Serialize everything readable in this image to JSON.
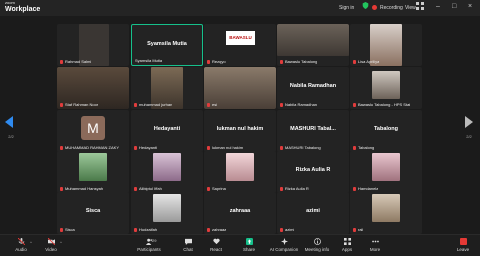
{
  "app": {
    "brand_top": "zoom",
    "brand_name": "Workplace"
  },
  "titlebar": {
    "signin": "Sign in",
    "recording": "Recording",
    "view": "View"
  },
  "pager": {
    "left": "2/2",
    "right": "2/2"
  },
  "tiles": [
    {
      "name": "Rahmad Salmi",
      "big": "",
      "muted": true
    },
    {
      "name": "Syamsila Mutia",
      "big": "Syamsila Mutia",
      "muted": false
    },
    {
      "name": "Rezqyo",
      "big": "",
      "muted": true
    },
    {
      "name": "Bawaslu Tabalong",
      "big": "",
      "muted": true
    },
    {
      "name": "Lisa Apriliya",
      "big": "",
      "muted": true
    },
    {
      "name": "Staf Rahman Noor",
      "big": "",
      "muted": true
    },
    {
      "name": "muhammad jurhan",
      "big": "",
      "muted": true
    },
    {
      "name": "esi",
      "big": "",
      "muted": true
    },
    {
      "name": "Nabila Ramadhan",
      "big": "Nabila Ramadhan",
      "muted": true
    },
    {
      "name": "Bawaslu Tabalong - HPS Staf",
      "big": "",
      "muted": true
    },
    {
      "name": "MUHAMMAD RAHMAN ZAKY",
      "big": "",
      "avatar": "M",
      "muted": true
    },
    {
      "name": "Hedayanti",
      "big": "Hedayanti",
      "muted": true
    },
    {
      "name": "lukman nul hakim",
      "big": "lukman nul hakim",
      "muted": true
    },
    {
      "name": "MASHURI Tabalong",
      "big": "MASHURI Tabal...",
      "muted": true
    },
    {
      "name": "Tabalong",
      "big": "Tabalong",
      "muted": true
    },
    {
      "name": "Muhammad Hansyah",
      "big": "",
      "muted": true
    },
    {
      "name": "Alibiptul Iffah",
      "big": "",
      "muted": true
    },
    {
      "name": "Saprina",
      "big": "",
      "muted": true
    },
    {
      "name": "Rizka Aulia R",
      "big": "Rizka Aulia R",
      "muted": true
    },
    {
      "name": "Hamdanela",
      "big": "",
      "muted": true
    },
    {
      "name": "Sisca",
      "big": "Sisca",
      "muted": true
    },
    {
      "name": "Hudzaifah",
      "big": "",
      "muted": true
    },
    {
      "name": "zahraaa",
      "big": "zahraaa",
      "muted": true
    },
    {
      "name": "azimi",
      "big": "azimi",
      "muted": true
    },
    {
      "name": "rali",
      "big": "",
      "muted": true
    }
  ],
  "toolbar": {
    "audio": "Audio",
    "video": "Video",
    "participants": "Participants",
    "participants_count": "29",
    "chat": "Chat",
    "react": "React",
    "share": "Share",
    "ai_companion": "AI Companion",
    "meeting_info": "Meeting info",
    "apps": "Apps",
    "more": "More",
    "leave": "Leave"
  },
  "colors": {
    "accent": "#16c08b",
    "nav_arrow": "#2f8bf0",
    "record": "#e53935"
  }
}
